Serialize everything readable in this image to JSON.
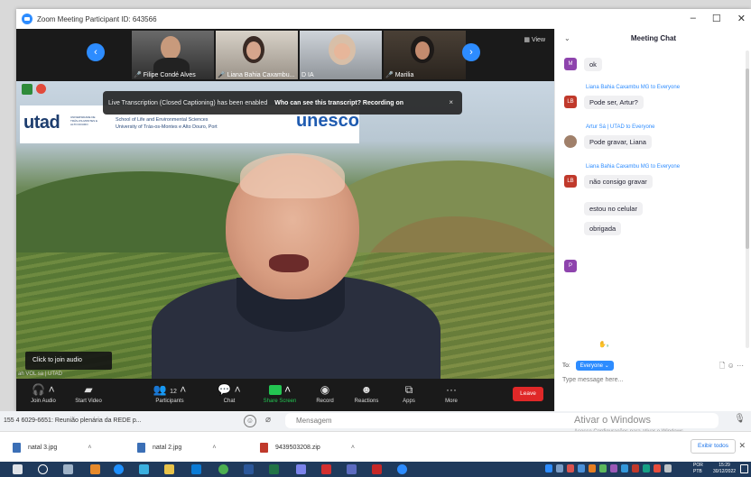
{
  "window": {
    "title": "Zoom Meeting Participant ID: 643566"
  },
  "participants": [
    {
      "name": "Filipe Condé Alves"
    },
    {
      "name": "Liana Bahia Caxambu..."
    },
    {
      "name": "D IA"
    },
    {
      "name": "Marilia"
    }
  ],
  "view_label": "View",
  "banner": {
    "text": "Live Transcription (Closed Captioning) has been enabled",
    "link": "Who can see this transcript? Recording on",
    "close": "×"
  },
  "slide": {
    "utad": "utad",
    "utad_small": "UNIVERSIDADE DE TRÁS-OS-MONTES E ALTO DOURO",
    "school_line1": "School of Life and Environmental Sciences",
    "school_line2": "University of Trás-os-Montes e Alto Douro, Port",
    "unesco": "unesco"
  },
  "join_audio_tip": "Click to join audio",
  "speaker_name": "ah VOL  sa | UTAD",
  "toolbar": {
    "join_audio": "Join Audio",
    "start_video": "Start Video",
    "participants": "Participants",
    "participant_count": "12",
    "chat": "Chat",
    "share_screen": "Share Screen",
    "record": "Record",
    "reactions": "Reactions",
    "apps": "Apps",
    "more": "More",
    "leave": "Leave"
  },
  "chat": {
    "title": "Meeting Chat",
    "messages": [
      {
        "avatar": "M",
        "color": "#8e44ad",
        "sender": "",
        "text": "ok"
      },
      {
        "avatar": "LB",
        "color": "#c0392b",
        "sender": "Liana Bahia Caxambu MG to Everyone",
        "text": "Pode ser, Artur?"
      },
      {
        "avatar": "",
        "color": "#a0806a",
        "sender": "Artur Sá | UTAD to Everyone",
        "text": "Pode gravar, Liana"
      },
      {
        "avatar": "LB",
        "color": "#c0392b",
        "sender": "Liana Bahia Caxambu MG to Everyone",
        "text": "não consigo gravar"
      },
      {
        "avatar": "",
        "color": "",
        "sender": "",
        "text": "estou no celular"
      },
      {
        "avatar": "",
        "color": "",
        "sender": "",
        "text": "obrigada"
      },
      {
        "avatar": "P",
        "color": "#8e44ad",
        "sender": "",
        "text": ""
      }
    ],
    "to_label": "To:",
    "to_value": "Everyone",
    "placeholder": "Type message here..."
  },
  "background": {
    "whatsapp_left": "155 4  6029-6651: Reunião plenária da REDE p...",
    "message_placeholder": "Mensagem",
    "activate_title": "Ativar o Windows",
    "activate_sub": "Acesse Configurações para ativar o Windows."
  },
  "downloads": [
    {
      "name": "natal 3.jpg",
      "color": "#3b6fb6"
    },
    {
      "name": "natal 2.jpg",
      "color": "#3b6fb6"
    },
    {
      "name": "9439503208.zip",
      "color": "#c0392b"
    }
  ],
  "show_all": "Exibir todos",
  "taskbar": {
    "lang1": "POR",
    "lang2": "PTB",
    "time": "15:29",
    "date": "30/12/2022"
  }
}
